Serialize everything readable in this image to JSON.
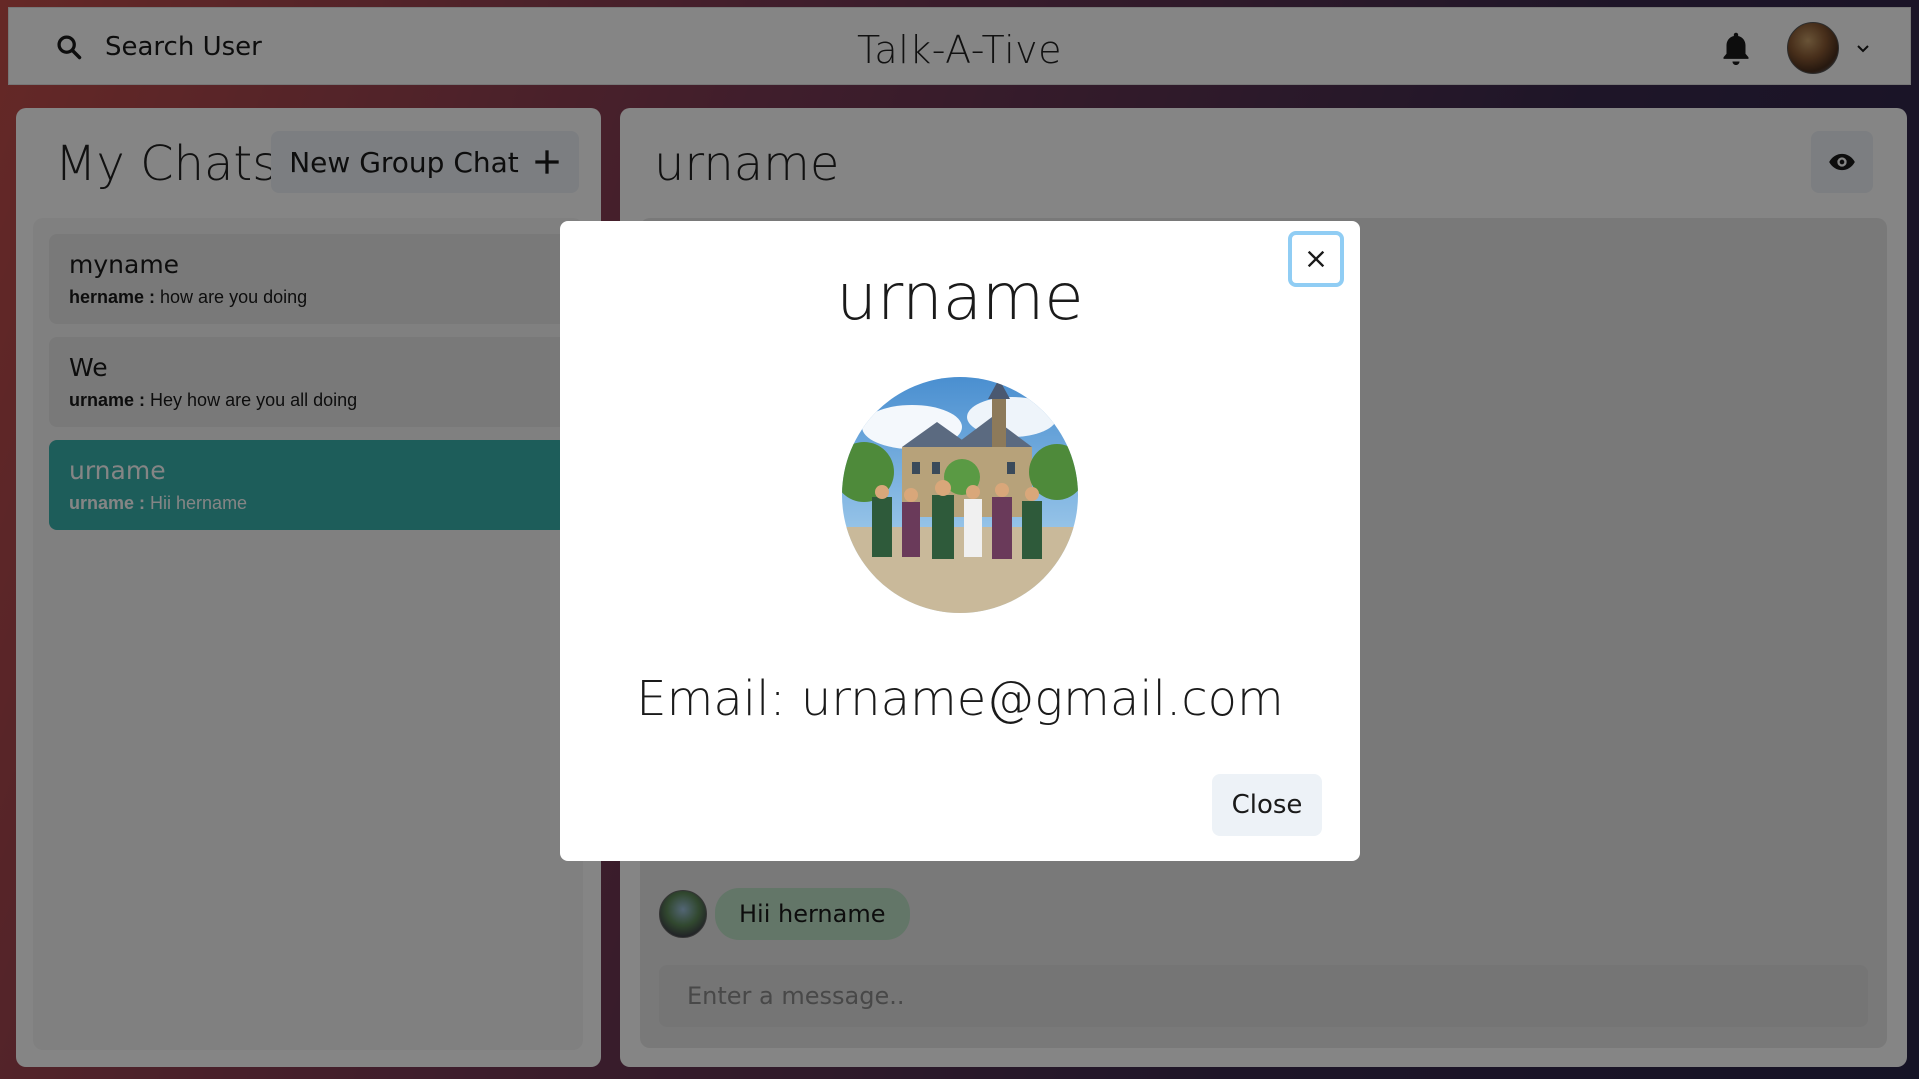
{
  "header": {
    "search_label": "Search User",
    "app_title": "Talk-A-Tive",
    "icons": [
      "search-icon",
      "bell-icon",
      "chevron-down-icon"
    ]
  },
  "chats": {
    "title": "My Chats",
    "new_group_label": "New Group Chat",
    "items": [
      {
        "name": "myname",
        "sender": "hername :",
        "latest": " how are you doing",
        "active": false
      },
      {
        "name": "We",
        "sender": "urname :",
        "latest": " Hey how are you all doing",
        "active": false
      },
      {
        "name": "urname",
        "sender": "urname :",
        "latest": " Hii hername",
        "active": true
      }
    ],
    "active_color": "#38b2ac"
  },
  "chatbox": {
    "title": "urname",
    "messages": [
      {
        "text": "Hii hername"
      }
    ],
    "input_placeholder": "Enter a message.."
  },
  "modal": {
    "title": "urname",
    "email": "Email: urname@gmail.com",
    "close_label": "Close"
  }
}
